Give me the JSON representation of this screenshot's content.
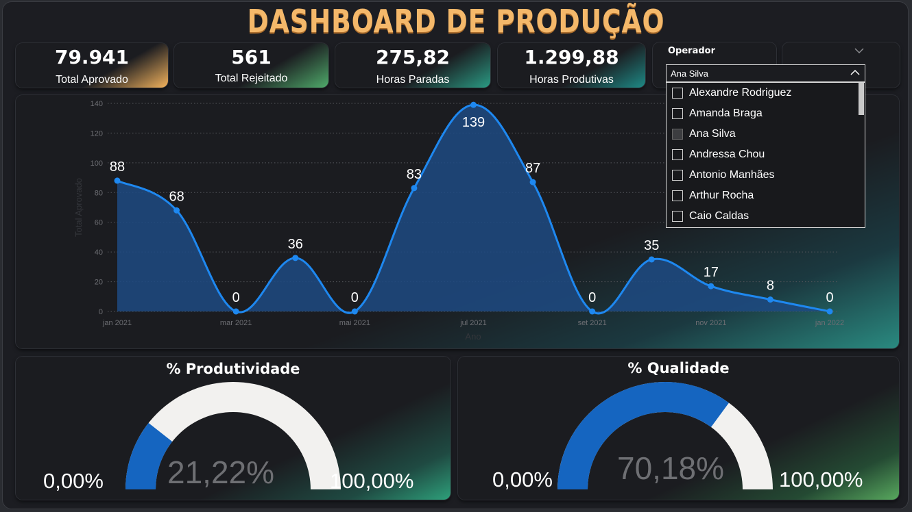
{
  "title": "DASHBOARD DE PRODUÇÃO",
  "kpis": [
    {
      "value": "79.941",
      "label": "Total Aprovado"
    },
    {
      "value": "561",
      "label": "Total Rejeitado"
    },
    {
      "value": "275,82",
      "label": "Horas Paradas"
    },
    {
      "value": "1.299,88",
      "label": "Horas Produtivas"
    }
  ],
  "slicer": {
    "title": "Operador",
    "selected": "Ana Silva",
    "items": [
      {
        "label": "Alexandre Rodriguez",
        "checked": false
      },
      {
        "label": "Amanda Braga",
        "checked": false
      },
      {
        "label": "Ana Silva",
        "checked": true
      },
      {
        "label": "Andressa Chou",
        "checked": false
      },
      {
        "label": "Antonio Manhães",
        "checked": false
      },
      {
        "label": "Arthur Rocha",
        "checked": false
      },
      {
        "label": "Caio Caldas",
        "checked": false
      }
    ]
  },
  "chart_data": {
    "type": "area",
    "xlabel": "Ano",
    "ylabel": "Total Aprovado",
    "ylim": [
      0,
      140
    ],
    "yticks": [
      0,
      20,
      40,
      60,
      80,
      100,
      120,
      140
    ],
    "xticks": [
      "jan 2021",
      "mar 2021",
      "mai 2021",
      "jul 2021",
      "set 2021",
      "nov 2021",
      "jan 2022"
    ],
    "x": [
      "jan 2021",
      "fev 2021",
      "mar 2021",
      "abr 2021",
      "mai 2021",
      "jun 2021",
      "jul 2021",
      "ago 2021",
      "set 2021",
      "out 2021",
      "nov 2021",
      "dez 2021",
      "jan 2022"
    ],
    "values": [
      88,
      68,
      0,
      36,
      0,
      83,
      139,
      87,
      0,
      35,
      17,
      8,
      0
    ],
    "grid": true,
    "line_color": "#1e88f0",
    "fill_color": "#1d4a82"
  },
  "gauges": [
    {
      "title": "% Produtividade",
      "value": "21,22%",
      "fraction": 0.2122,
      "min": "0,00%",
      "max": "100,00%"
    },
    {
      "title": "% Qualidade",
      "value": "70,18%",
      "fraction": 0.7018,
      "min": "0,00%",
      "max": "100,00%"
    }
  ],
  "colors": {
    "accent": "#f4b86a",
    "gauge_fill": "#1565c0",
    "gauge_track": "#f2f1ef"
  }
}
